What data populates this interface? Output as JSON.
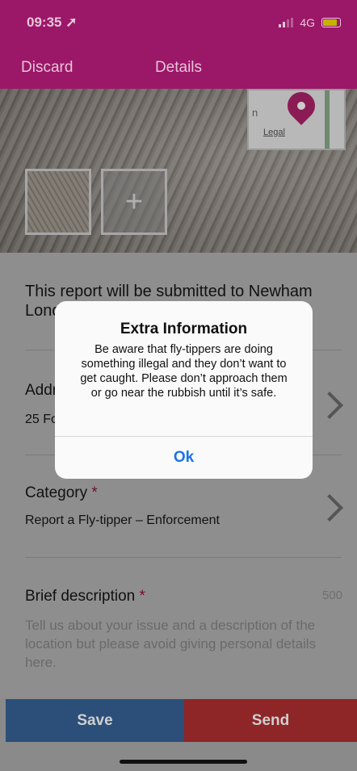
{
  "status": {
    "time": "09:35 ➚",
    "network": "4G"
  },
  "header": {
    "discard": "Discard",
    "title": "Details"
  },
  "map": {
    "legal": "Legal",
    "label_fragment": "n"
  },
  "photos": {
    "add_icon": "plus-icon"
  },
  "form": {
    "submit_text": "This report will be submitted to Newham London",
    "address": {
      "label": "Address",
      "value": "25 Fo"
    },
    "category": {
      "label": "Category",
      "required": "*",
      "value": "Report a Fly-tipper – Enforcement"
    },
    "description": {
      "label": "Brief description",
      "required": "*",
      "counter": "500",
      "placeholder": "Tell us about your issue and a description of the location but please avoid giving personal details here."
    }
  },
  "buttons": {
    "save": "Save",
    "send": "Send"
  },
  "alert": {
    "title": "Extra Information",
    "message": "Be aware that fly-tippers are doing something illegal and they don’t want to get caught. Please don’t approach them or go near the rubbish until it’s safe.",
    "ok": "Ok"
  },
  "colors": {
    "header": "#9b1768",
    "save": "#2b4f79",
    "send": "#8e2527",
    "link": "#1a73e8"
  }
}
